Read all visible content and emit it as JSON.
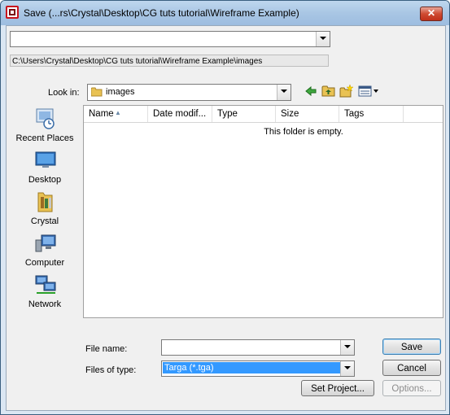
{
  "window": {
    "title": "Save (...rs\\Crystal\\Desktop\\CG tuts tutorial\\Wireframe Example)",
    "close_symbol": "✕",
    "close_icon": "close-icon"
  },
  "history": {
    "value": "",
    "current_path": "C:\\Users\\Crystal\\Desktop\\CG tuts tutorial\\Wireframe Example\\images"
  },
  "look_in": {
    "label": "Look in:",
    "value": "images",
    "icon": "folder-icon"
  },
  "toolbar": {
    "back_icon": "back-arrow-icon",
    "up_icon": "up-folder-icon",
    "new_folder_icon": "new-folder-icon",
    "views_icon": "views-menu-icon"
  },
  "places": [
    {
      "label": "Recent Places",
      "icon": "recent-places-icon"
    },
    {
      "label": "Desktop",
      "icon": "desktop-icon"
    },
    {
      "label": "Crystal",
      "icon": "user-folder-icon"
    },
    {
      "label": "Computer",
      "icon": "computer-icon"
    },
    {
      "label": "Network",
      "icon": "network-icon"
    }
  ],
  "file_list": {
    "columns": [
      "Name",
      "Date modif...",
      "Type",
      "Size",
      "Tags"
    ],
    "empty_message": "This folder is empty."
  },
  "file_name": {
    "label": "File name:",
    "value": ""
  },
  "file_type": {
    "label": "Files of type:",
    "value": "Targa (*.tga)"
  },
  "buttons": {
    "save": "Save",
    "cancel": "Cancel",
    "set_project": "Set Project...",
    "options": "Options..."
  },
  "colors": {
    "title_gradient": "#a9c6e4",
    "close_button": "#c0301a",
    "selection": "#3399ff",
    "dialog_bg": "#f0f0f0"
  }
}
